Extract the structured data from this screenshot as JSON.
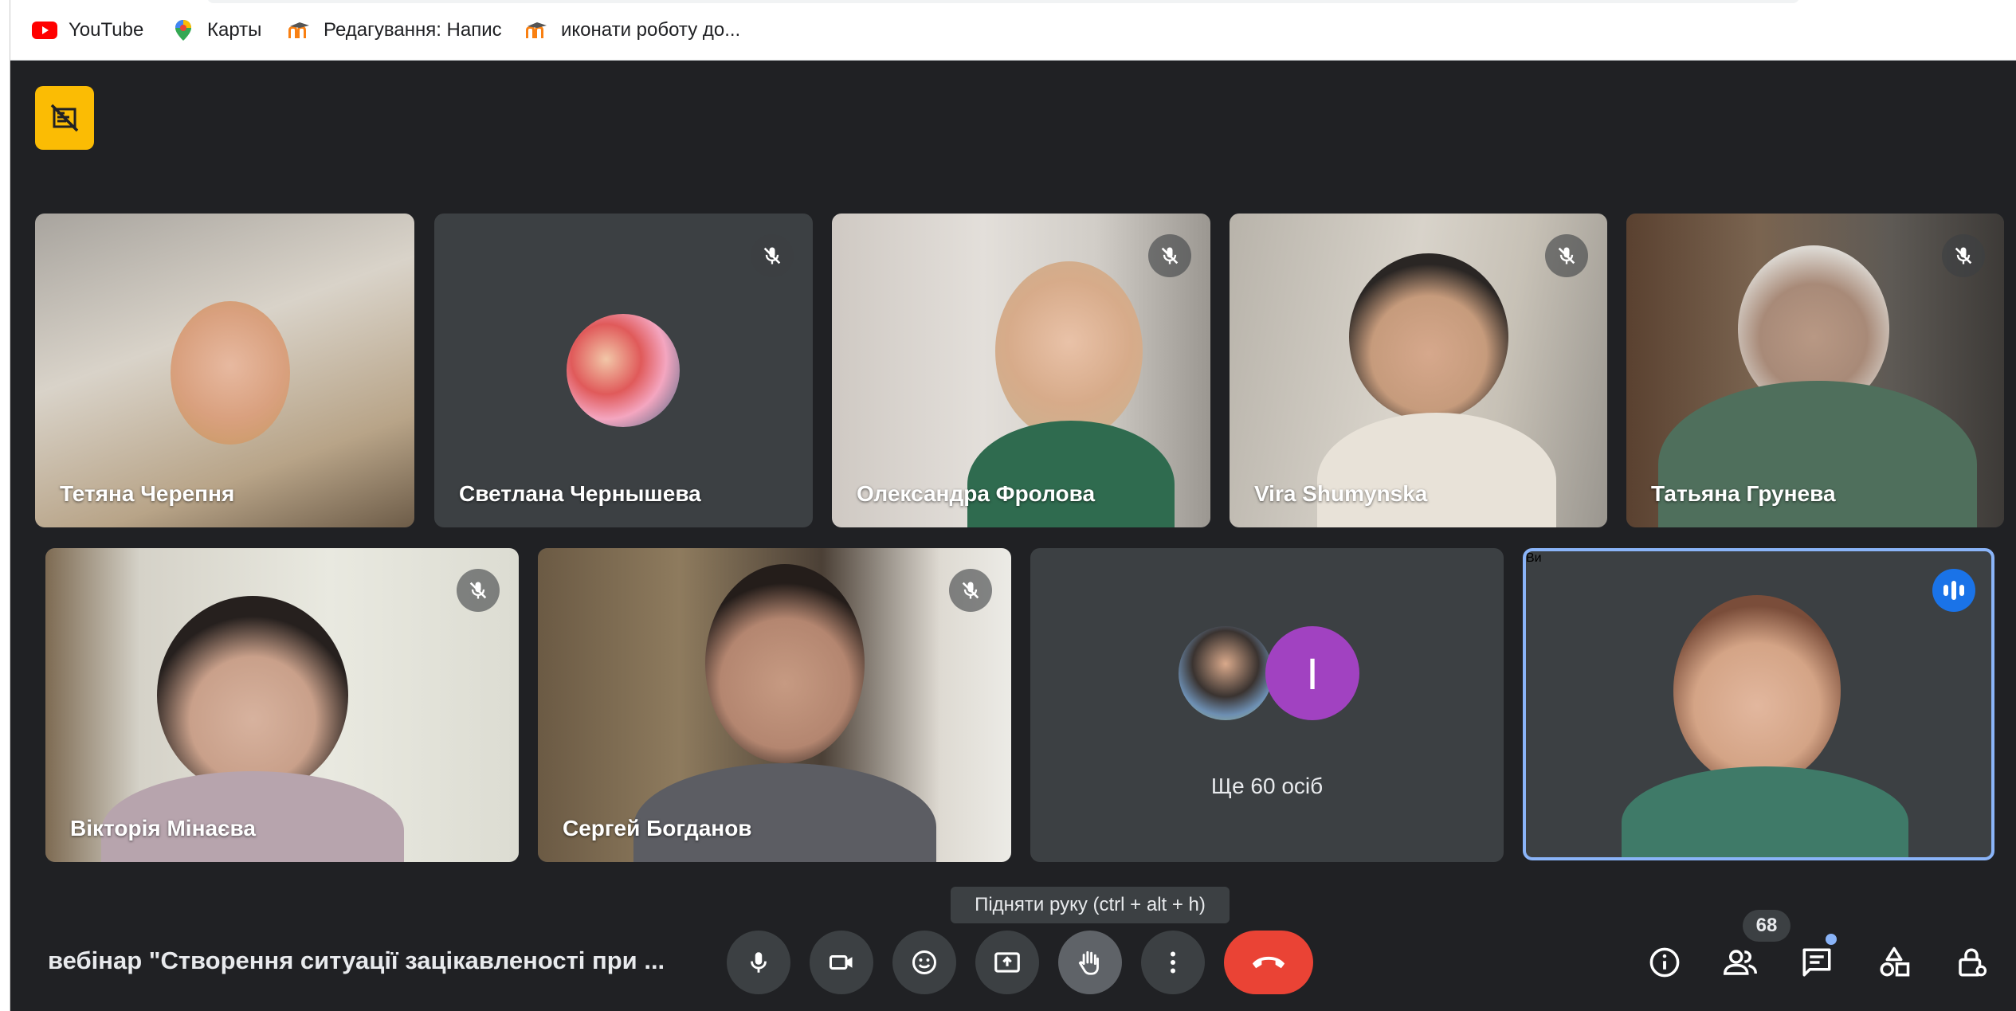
{
  "bookmarks": [
    {
      "label": "YouTube",
      "icon": "youtube-icon"
    },
    {
      "label": "Карты",
      "icon": "maps-pin-icon"
    },
    {
      "label": "Редагування: Напис",
      "icon": "moodle-icon"
    },
    {
      "label": "иконати роботу до...",
      "icon": "moodle-icon"
    }
  ],
  "participants_row1": [
    {
      "name": "Тетяна Черепня",
      "muted": false
    },
    {
      "name": "Светлана Чернышева",
      "muted": true
    },
    {
      "name": "Олександра Фролова",
      "muted": true
    },
    {
      "name": "Vira Shumynska",
      "muted": true
    },
    {
      "name": "Татьяна Грунева",
      "muted": true
    }
  ],
  "participants_row2": [
    {
      "name": "Вікторія Мінаєва",
      "muted": true
    },
    {
      "name": "Сергей Богданов",
      "muted": true
    }
  ],
  "more_tile": {
    "label": "Ще 60 осіб",
    "avatar_letter": "I"
  },
  "self_tile": {
    "name": "Ви"
  },
  "tooltip": "Підняти руку (ctrl + alt + h)",
  "meeting_title": "вебінар \"Створення ситуації зацікавленості при ...",
  "participant_count": "68",
  "colors": {
    "accent": "#8ab4f8",
    "end_call": "#ea4335",
    "shield": "#fbbc04",
    "avatar_purple": "#a142c1"
  }
}
